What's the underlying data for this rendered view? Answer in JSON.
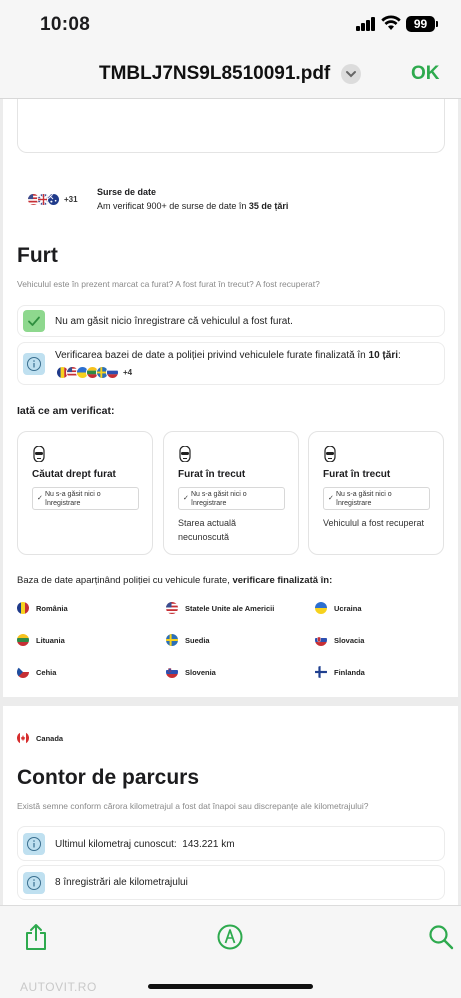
{
  "status_bar": {
    "time": "10:08",
    "battery": "99"
  },
  "nav": {
    "title": "TMBLJ7NS9L8510091.pdf",
    "done": "OK"
  },
  "sources": {
    "more_count": "+31",
    "title": "Surse de date",
    "desc_prefix": "Am verificat 900+ de surse de date în",
    "desc_bold": "35 de țări"
  },
  "theft": {
    "heading": "Furt",
    "subtitle": "Vehiculul este în prezent marcat ca furat? A fost furat în trecut? A fost recuperat?",
    "row1": "Nu am găsit nicio înregistrare că vehiculul a fost furat.",
    "row2_prefix": "Verificarea bazei de date a poliției privind vehiculele furate finalizată în",
    "row2_bold": "10 țări",
    "row2_suffix": ":",
    "row2_more": "+4",
    "checked_heading": "Iată ce am verificat:",
    "cards": [
      {
        "title": "Căutat drept furat",
        "chip": "Nu s-a găsit nici o înregistrare",
        "note": ""
      },
      {
        "title": "Furat în trecut",
        "chip": "Nu s-a găsit nici o înregistrare",
        "note": "Starea actuală necunoscută"
      },
      {
        "title": "Furat în trecut",
        "chip": "Nu s-a găsit nici o înregistrare",
        "note": "Vehiculul a fost recuperat"
      }
    ],
    "db_prefix": "Baza de date aparținând poliției cu vehicule furate,",
    "db_bold": "verificare finalizată în:",
    "countries": [
      {
        "name": "România",
        "flag": "ro"
      },
      {
        "name": "Statele Unite ale Americii",
        "flag": "us"
      },
      {
        "name": "Ucraina",
        "flag": "ua"
      },
      {
        "name": "Lituania",
        "flag": "lt"
      },
      {
        "name": "Suedia",
        "flag": "se"
      },
      {
        "name": "Slovacia",
        "flag": "sk"
      },
      {
        "name": "Cehia",
        "flag": "cz"
      },
      {
        "name": "Slovenia",
        "flag": "si"
      },
      {
        "name": "Finlanda",
        "flag": "fi"
      }
    ]
  },
  "odometer": {
    "top_country": "Canada",
    "heading": "Contor de parcurs",
    "subtitle": "Există semne conform cărora kilometrajul a fost dat înapoi sau discrepanțe ale kilometrajului?",
    "row1_label": "Ultimul kilometraj cunoscut:",
    "row1_value": "143.221 km",
    "row2": "8 înregistrări ale kilometrajului"
  },
  "toolbar": {
    "share": "share-icon",
    "markup": "markup-icon",
    "search": "search-icon"
  },
  "watermark": "AUTOVIT.RO",
  "colors": {
    "accent_green": "#2eaa4e",
    "check_green": "#8ed88e",
    "info_blue": "#bfe0f0"
  }
}
